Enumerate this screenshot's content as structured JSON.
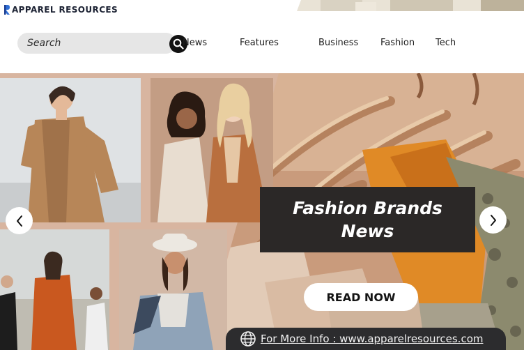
{
  "brand": {
    "name": "APPAREL RESOURCES",
    "logo_color": "#2f6fd6"
  },
  "search": {
    "placeholder": "Search",
    "icon": "search-icon"
  },
  "nav": {
    "items": [
      {
        "label": "News"
      },
      {
        "label": "Features"
      },
      {
        "label": "Business"
      },
      {
        "label": "Fashion"
      },
      {
        "label": "Tech"
      }
    ]
  },
  "hero": {
    "headline": "Fashion Brands News",
    "cta_label": "READ NOW",
    "prev_icon": "chevron-left-icon",
    "next_icon": "chevron-right-icon",
    "info_icon": "globe-icon",
    "info_text": "For More Info : www.apparelresources.com",
    "photos": [
      {
        "name": "photo-trench-coat-model"
      },
      {
        "name": "photo-two-women-coats"
      },
      {
        "name": "photo-group-on-beach"
      },
      {
        "name": "photo-woman-in-hat"
      },
      {
        "name": "photo-clothes-on-hangers"
      }
    ]
  },
  "colors": {
    "headline_bg": "#2b2827",
    "info_bar_bg": "#2c2c2e",
    "search_bg": "#e6e6e6",
    "hero_tone": "#d8b5a0"
  }
}
